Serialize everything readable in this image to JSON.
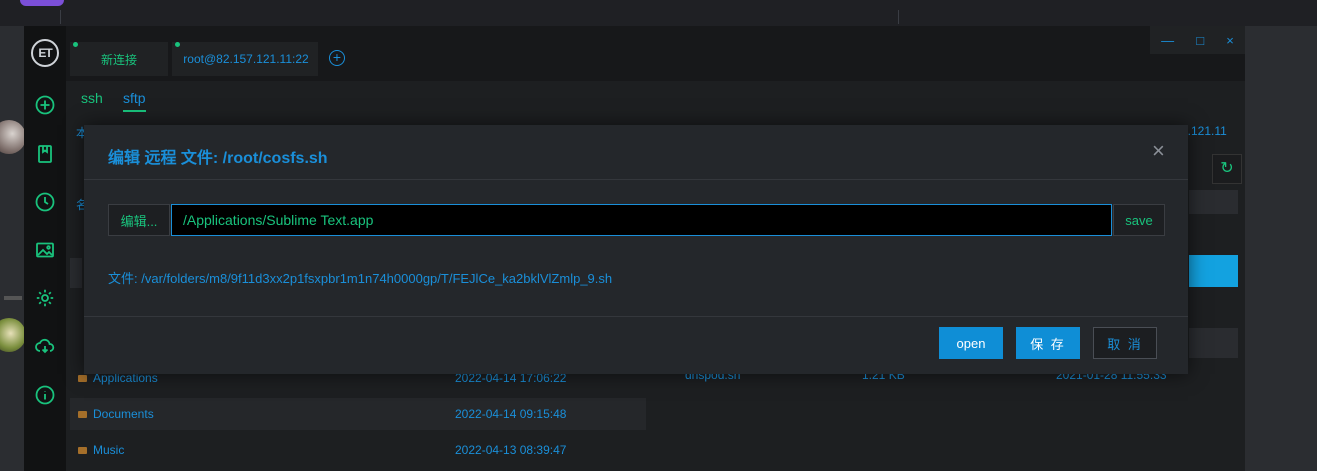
{
  "tabs": {
    "new_label": "新连接",
    "host_label": "root@82.157.121.11:22",
    "add_symbol": "+"
  },
  "window_controls": [
    "—",
    "□",
    "×"
  ],
  "logo_text": "ET",
  "subtabs": {
    "ssh": "ssh",
    "sftp": "sftp"
  },
  "background": {
    "right_host_fragment": "7.121.11",
    "left_fragment_1": "本",
    "left_fragment_2": "名",
    "rows": [
      {
        "name": "Applications",
        "date": "2022-04-14 17:06:22"
      },
      {
        "name": "Documents",
        "date": "2022-04-14 09:15:48"
      },
      {
        "name": "Music",
        "date": "2022-04-13 08:39:47"
      }
    ],
    "remote_file": {
      "name": "dnspod.sh",
      "size": "1.21 KB",
      "date": "2021-01-28 11:55:33"
    },
    "refresh_symbol": "↻"
  },
  "dialog": {
    "title": "编辑 远程 文件: /root/cosfs.sh",
    "close_symbol": "×",
    "edit_button": "编辑...",
    "app_path": "/Applications/Sublime Text.app",
    "save_button": "save",
    "file_info": "文件: /var/folders/m8/9f11d3xx2p1fsxpbr1m1n74h0000gp/T/FEJlCe_ka2bklVlZmlp_9.sh",
    "open_button": "open",
    "keep_button": "保 存",
    "cancel_button": "取 消"
  },
  "colors": {
    "accent_blue": "#1a8fd9",
    "accent_green": "#19c37d",
    "button_blue": "#0f8ed6"
  }
}
